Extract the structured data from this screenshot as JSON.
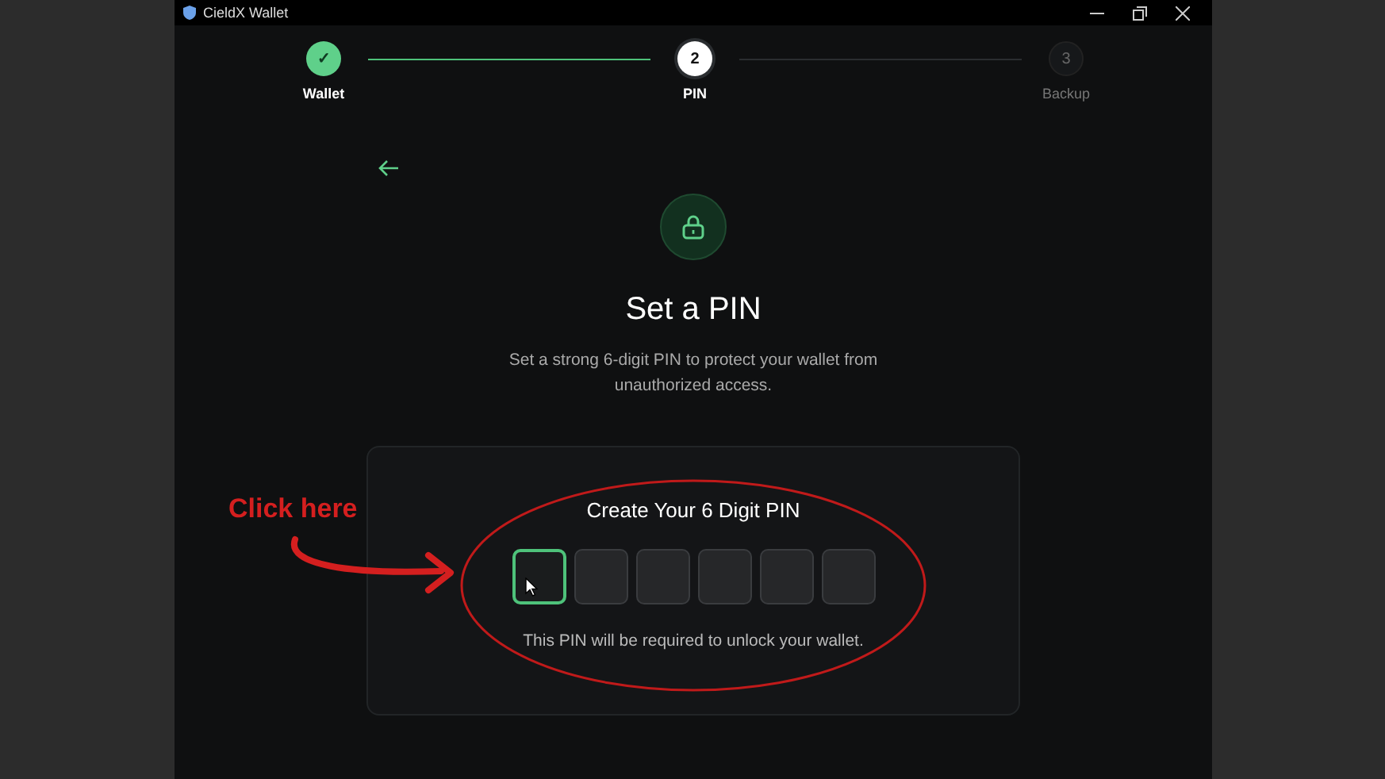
{
  "window": {
    "title": "CieldX Wallet"
  },
  "steps": [
    {
      "label": "Wallet",
      "marker": "✓",
      "completed": true,
      "selected": false
    },
    {
      "label": "PIN",
      "marker": "2",
      "completed": false,
      "selected": true
    },
    {
      "label": "Backup",
      "marker": "3",
      "completed": false,
      "selected": false
    }
  ],
  "heading": "Set a PIN",
  "description": "Set a strong 6-digit PIN to protect your wallet from unauthorized access.",
  "pin_card": {
    "title": "Create Your 6 Digit PIN",
    "boxes": [
      {
        "focused": true
      },
      {
        "focused": false
      },
      {
        "focused": false
      },
      {
        "focused": false
      },
      {
        "focused": false
      },
      {
        "focused": false
      }
    ],
    "hint": "This PIN will be required to unlock your wallet."
  },
  "annotation": {
    "text": "Click here"
  }
}
